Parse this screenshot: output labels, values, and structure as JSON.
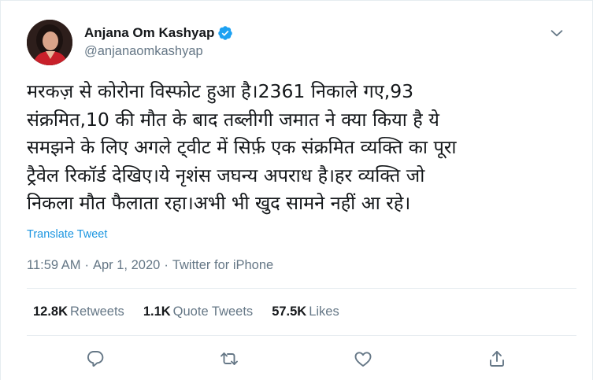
{
  "tweet": {
    "author": {
      "display_name": "Anjana Om Kashyap",
      "handle": "@anjanaomkashyap",
      "verified": true
    },
    "text": "मरकज़ से कोरोना विस्फोट हुआ है।2361 निकाले गए,93\nसंक्रमित,10 की मौत के बाद तब्लीगी जमात ने क्या किया है ये\nसमझने के लिए अगले ट्वीट में सिर्फ़ एक संक्रमित व्यक्ति का पूरा\nट्रैवेल रिकॉर्ड देखिए।ये नृशंस जघन्य अपराध है।हर व्यक्ति जो\nनिकला मौत फैलाता रहा।अभी भी खुद सामने नहीं आ रहे।",
    "translate_label": "Translate Tweet",
    "meta": {
      "time": "11:59 AM",
      "separator1": "·",
      "date": "Apr 1, 2020",
      "separator2": "·",
      "source": "Twitter for iPhone"
    },
    "stats": {
      "retweets_count": "12.8K",
      "retweets_label": "Retweets",
      "quotes_count": "1.1K",
      "quotes_label": "Quote Tweets",
      "likes_count": "57.5K",
      "likes_label": "Likes"
    },
    "actions": [
      "reply-icon",
      "retweet-icon",
      "like-icon",
      "share-icon"
    ]
  },
  "colors": {
    "text_primary": "#14171a",
    "text_secondary": "#657786",
    "link": "#1b95e0",
    "verified_badge": "#1da1f2",
    "divider": "#e6ecf0"
  }
}
